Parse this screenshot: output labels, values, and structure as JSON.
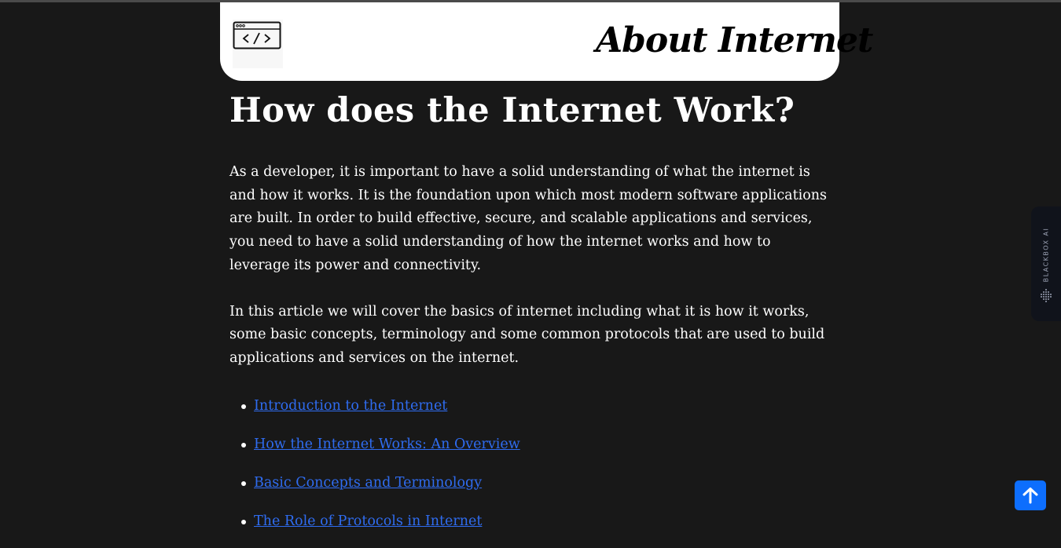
{
  "header": {
    "title": "About Internet",
    "logo_icon": "code-window-icon"
  },
  "article": {
    "heading": "How does the Internet Work?",
    "paragraph1": "As a developer, it is important to have a solid understanding of what the internet is and how it works. It is the foundation upon which most modern software applications are built. In order to build effective, secure, and scalable applications and services, you need to have a solid understanding of how the internet works and how to leverage its power and connectivity.",
    "paragraph2": "In this article we will cover the basics of internet including what it is how it works, some basic concepts, terminology and some common protocols that are used to build applications and services on the internet.",
    "toc": [
      {
        "label": "Introduction to the Internet"
      },
      {
        "label": "How the Internet Works: An Overview"
      },
      {
        "label": "Basic Concepts and Terminology"
      },
      {
        "label": "The Role of Protocols in Internet"
      }
    ]
  },
  "side_widget": {
    "label": "BLACKBOX AI",
    "icon": "blackbox-dots-icon"
  },
  "back_to_top": {
    "icon": "arrow-up-icon"
  },
  "colors": {
    "background": "#181818",
    "link": "#2f6cf0",
    "button": "#0d6efd"
  }
}
